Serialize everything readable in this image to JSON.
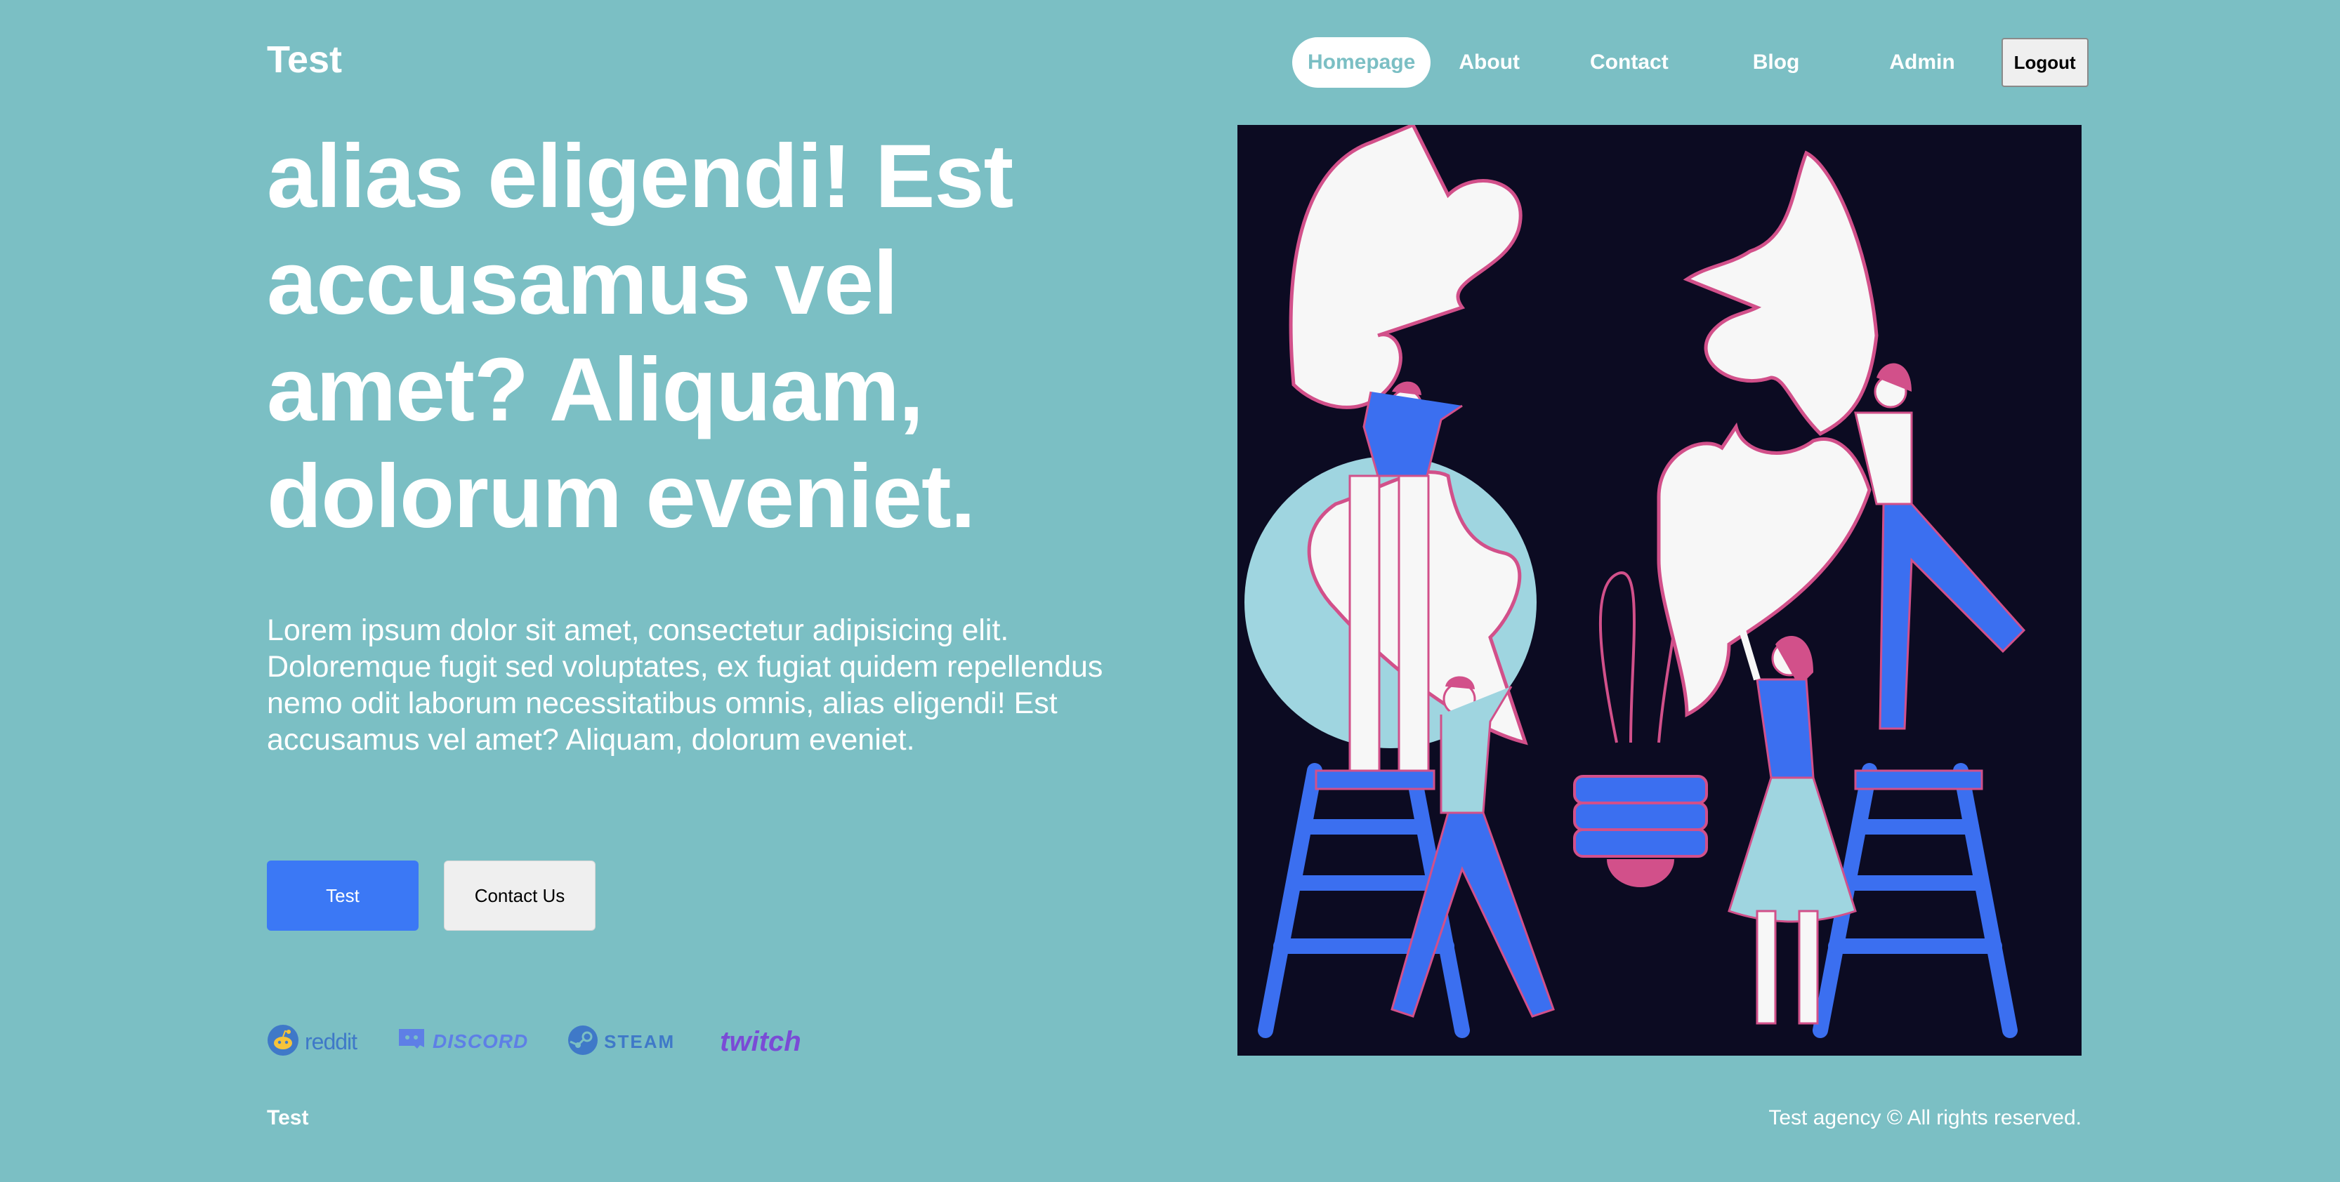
{
  "header": {
    "brand": "Test",
    "nav": [
      "Homepage",
      "About",
      "Contact",
      "Blog",
      "Admin"
    ],
    "logout": "Logout"
  },
  "hero": {
    "headline": "alias eligendi! Est accusamus vel amet? Aliquam, dolorum eveniet.",
    "lead": "Lorem ipsum dolor sit amet, consectetur adipisicing elit. Doloremque fugit sed voluptates, ex fugiat quidem repellendus nemo odit laborum necessitatibus omnis, alias eligendi! Est accusamus vel amet? Aliquam, dolorum eveniet.",
    "primary_button": "Test",
    "secondary_button": "Contact Us"
  },
  "partners": [
    {
      "name": "reddit",
      "icon": "reddit-icon",
      "color": "#3f79c8"
    },
    {
      "name": "DISCORD",
      "icon": "discord-icon",
      "color": "#5e7fe6"
    },
    {
      "name": "STEAM",
      "icon": "steam-icon",
      "color": "#3f79c8"
    },
    {
      "name": "twitch",
      "icon": "twitch-icon",
      "color": "#7a4bd6"
    }
  ],
  "footer": {
    "brand": "Test",
    "copyright": "Test agency © All rights reserved."
  },
  "colors": {
    "background": "#7bbfc4",
    "accent": "#3b78f5",
    "illustration_bg": "#0c0b22",
    "illustration_pink": "#d2508a",
    "illustration_blue": "#3b6ff0"
  }
}
